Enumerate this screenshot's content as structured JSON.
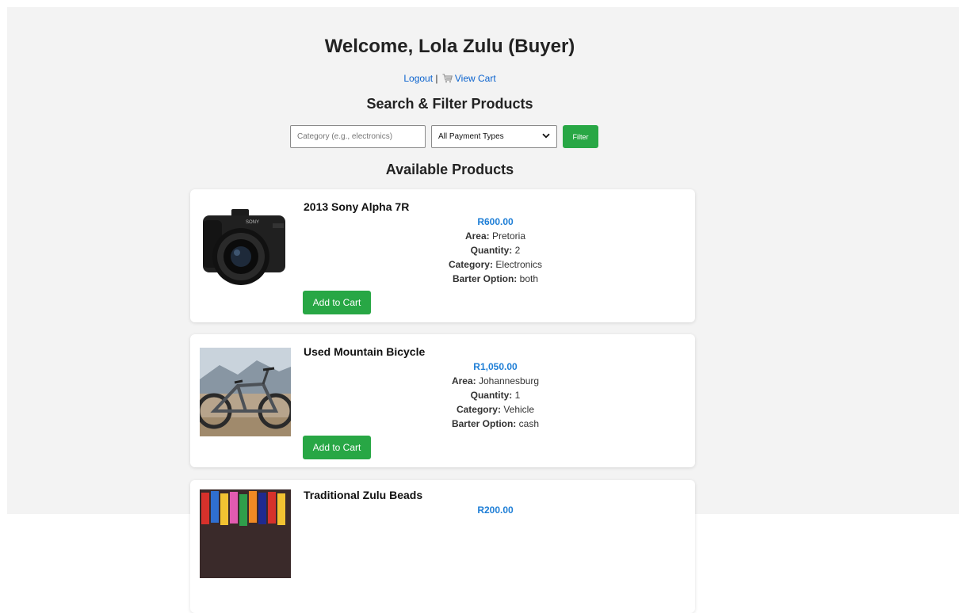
{
  "header": {
    "welcome": "Welcome, Lola Zulu (Buyer)",
    "logout": "Logout",
    "separator": "|",
    "view_cart": "View Cart",
    "cart_icon": "shopping-cart-icon"
  },
  "filters": {
    "title": "Search & Filter Products",
    "category_placeholder": "Category (e.g., electronics)",
    "category_value": "",
    "payment_selected": "All Payment Types",
    "filter_button": "Filter"
  },
  "products_section": {
    "title": "Available Products"
  },
  "products": [
    {
      "name": "2013 Sony Alpha 7R",
      "price": "R600.00",
      "area_label": "Area:",
      "area": "Pretoria",
      "quantity_label": "Quantity:",
      "quantity": "2",
      "category_label": "Category:",
      "category": "Electronics",
      "barter_label": "Barter Option:",
      "barter": "both",
      "button": "Add to Cart",
      "image": "camera-photo"
    },
    {
      "name": "Used Mountain Bicycle",
      "price": "R1,050.00",
      "area_label": "Area:",
      "area": "Johannesburg",
      "quantity_label": "Quantity:",
      "quantity": "1",
      "category_label": "Category:",
      "category": "Vehicle",
      "barter_label": "Barter Option:",
      "barter": "cash",
      "button": "Add to Cart",
      "image": "bicycle-photo"
    },
    {
      "name": "Traditional Zulu Beads",
      "price": "R200.00",
      "image": "beads-photo"
    }
  ],
  "colors": {
    "accent_green": "#28a745",
    "link_blue": "#0b63ce",
    "price_blue": "#1e7ed6",
    "page_bg": "#f3f3f3"
  }
}
